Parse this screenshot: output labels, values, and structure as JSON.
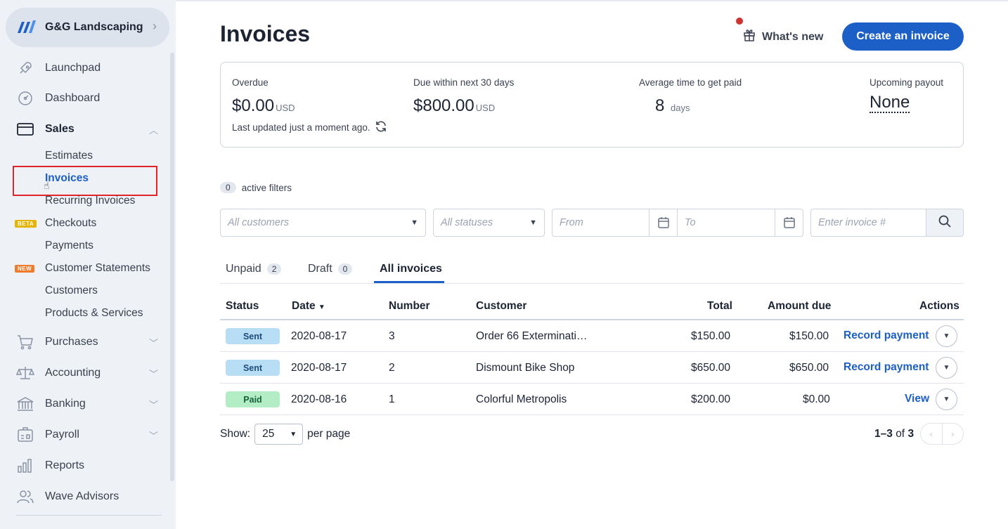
{
  "business": {
    "name": "G&G Landscaping"
  },
  "nav": {
    "launchpad": "Launchpad",
    "dashboard": "Dashboard",
    "sales": "Sales",
    "sales_items": {
      "estimates": "Estimates",
      "invoices": "Invoices",
      "recurring": "Recurring Invoices",
      "checkouts": "Checkouts",
      "payments": "Payments",
      "statements": "Customer Statements",
      "customers": "Customers",
      "products": "Products & Services"
    },
    "tags": {
      "beta": "BETA",
      "new": "NEW"
    },
    "purchases": "Purchases",
    "accounting": "Accounting",
    "banking": "Banking",
    "payroll": "Payroll",
    "reports": "Reports",
    "advisors": "Wave Advisors"
  },
  "header": {
    "title": "Invoices",
    "whats_new": "What's new",
    "create_button": "Create an invoice"
  },
  "summary": {
    "overdue_label": "Overdue",
    "overdue_value": "$0.00",
    "overdue_unit": "USD",
    "due30_label": "Due within next 30 days",
    "due30_value": "$800.00",
    "due30_unit": "USD",
    "avg_label": "Average time to get paid",
    "avg_value": "8",
    "avg_unit": "days",
    "payout_label": "Upcoming payout",
    "payout_value": "None",
    "updated": "Last updated just a moment ago."
  },
  "filters": {
    "active_count": "0",
    "active_label": "active filters",
    "customers_placeholder": "All customers",
    "statuses_placeholder": "All statuses",
    "from_placeholder": "From",
    "to_placeholder": "To",
    "invoice_placeholder": "Enter invoice #"
  },
  "tabs": [
    {
      "label": "Unpaid",
      "count": "2"
    },
    {
      "label": "Draft",
      "count": "0"
    },
    {
      "label": "All invoices"
    }
  ],
  "table": {
    "headers": {
      "status": "Status",
      "date": "Date",
      "number": "Number",
      "customer": "Customer",
      "total": "Total",
      "amount_due": "Amount due",
      "actions": "Actions"
    },
    "rows": [
      {
        "status": "Sent",
        "date": "2020-08-17",
        "number": "3",
        "customer": "Order 66 Exterminati…",
        "total": "$150.00",
        "amount_due": "$150.00",
        "action": "Record payment"
      },
      {
        "status": "Sent",
        "date": "2020-08-17",
        "number": "2",
        "customer": "Dismount Bike Shop",
        "total": "$650.00",
        "amount_due": "$650.00",
        "action": "Record payment"
      },
      {
        "status": "Paid",
        "date": "2020-08-16",
        "number": "1",
        "customer": "Colorful Metropolis",
        "total": "$200.00",
        "amount_due": "$0.00",
        "action": "View"
      }
    ]
  },
  "pagination": {
    "show_label": "Show:",
    "per_page_value": "25",
    "per_page_label": "per page",
    "range": "1–3",
    "of_label": "of",
    "total": "3"
  },
  "colors": {
    "accent": "#1c5fc7",
    "sent_badge": "#b8def5",
    "paid_badge": "#b3edc6",
    "highlight": "#e0242b"
  }
}
